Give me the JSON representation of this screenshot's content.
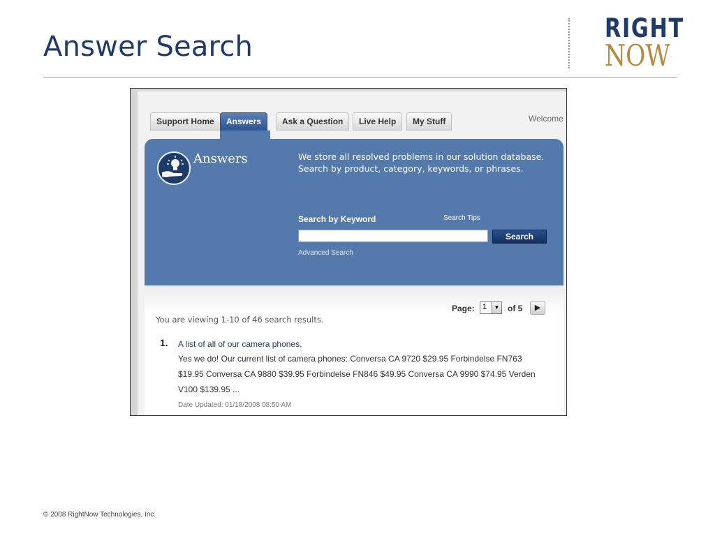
{
  "slide": {
    "title": "Answer Search",
    "footer": "© 2008 RightNow Technologies, Inc.",
    "logo": {
      "line1": "RIGHT",
      "line2": "NOW",
      "reg": "."
    }
  },
  "tabs": [
    {
      "label": "Support Home",
      "active": false
    },
    {
      "label": "Answers",
      "active": true
    },
    {
      "label": "Ask a Question",
      "active": false
    },
    {
      "label": "Live Help",
      "active": false
    },
    {
      "label": "My Stuff",
      "active": false
    }
  ],
  "welcome_text": "Welcome",
  "panel": {
    "heading": "Answers",
    "description": "We store all resolved problems in our solution database. Search by product, category, keywords, or phrases.",
    "keyword_label": "Search by Keyword",
    "search_tips": "Search Tips",
    "search_value": "",
    "search_button": "Search",
    "advanced_search": "Advanced Search"
  },
  "results": {
    "page_label": "Page:",
    "page_current": "1",
    "page_of": "of 5",
    "next_icon": "play-arrow-icon",
    "viewing_text": "You are viewing 1-10 of 46 search results.",
    "items": [
      {
        "rank": "1.",
        "title": "A list of all of our camera phones.",
        "excerpt": "Yes we do! Our current list of camera phones: Conversa CA 9720 $29.95 Forbindelse FN763 $19.95 Conversa CA 9880 $39.95 Forbindelse FN846 $49.95 Conversa CA 9990 $74.95 Verden V100 $139.95 ...",
        "date": "Date Updated: 01/18/2008 08:50 AM"
      }
    ]
  },
  "colors": {
    "title_blue": "#1f3a6b",
    "logo_gold": "#b9893c",
    "panel_blue": "#5479ad",
    "button_navy": "#13305f"
  }
}
